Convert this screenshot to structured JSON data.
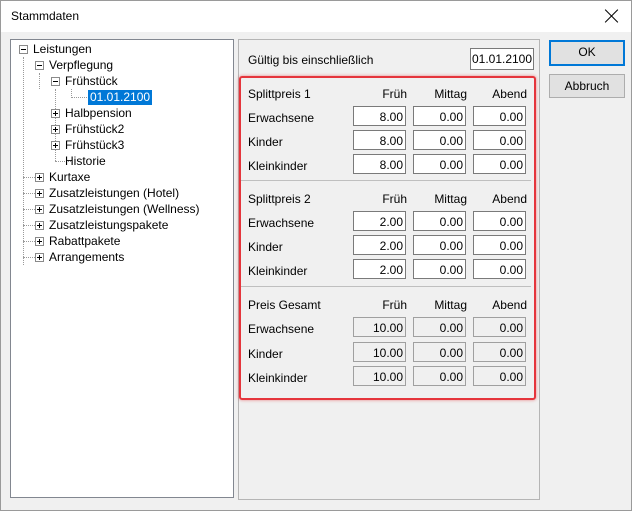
{
  "window": {
    "title": "Stammdaten"
  },
  "tree": {
    "items": [
      {
        "label": "Leistungen"
      },
      {
        "label": "Verpflegung"
      },
      {
        "label": "Frühstück"
      },
      {
        "label": "01.01.2100"
      },
      {
        "label": "Halbpension"
      },
      {
        "label": "Frühstück2"
      },
      {
        "label": "Frühstück3"
      },
      {
        "label": "Historie"
      },
      {
        "label": "Kurtaxe"
      },
      {
        "label": "Zusatzleistungen (Hotel)"
      },
      {
        "label": "Zusatzleistungen (Wellness)"
      },
      {
        "label": "Zusatzleistungspakete"
      },
      {
        "label": "Rabattpakete"
      },
      {
        "label": "Arrangements"
      }
    ]
  },
  "gueltig": {
    "label": "Gültig bis einschließlich",
    "value": "01.01.2100"
  },
  "sections": [
    {
      "title": "Splittpreis 1",
      "cols": [
        "Früh",
        "Mittag",
        "Abend"
      ],
      "rows": [
        {
          "label": "Erwachsene",
          "values": [
            "8.00",
            "0.00",
            "0.00"
          ]
        },
        {
          "label": "Kinder",
          "values": [
            "8.00",
            "0.00",
            "0.00"
          ]
        },
        {
          "label": "Kleinkinder",
          "values": [
            "8.00",
            "0.00",
            "0.00"
          ]
        }
      ]
    },
    {
      "title": "Splittpreis 2",
      "cols": [
        "Früh",
        "Mittag",
        "Abend"
      ],
      "rows": [
        {
          "label": "Erwachsene",
          "values": [
            "2.00",
            "0.00",
            "0.00"
          ]
        },
        {
          "label": "Kinder",
          "values": [
            "2.00",
            "0.00",
            "0.00"
          ]
        },
        {
          "label": "Kleinkinder",
          "values": [
            "2.00",
            "0.00",
            "0.00"
          ]
        }
      ]
    },
    {
      "title": "Preis Gesamt",
      "cols": [
        "Früh",
        "Mittag",
        "Abend"
      ],
      "rows": [
        {
          "label": "Erwachsene",
          "values": [
            "10.00",
            "0.00",
            "0.00"
          ]
        },
        {
          "label": "Kinder",
          "values": [
            "10.00",
            "0.00",
            "0.00"
          ]
        },
        {
          "label": "Kleinkinder",
          "values": [
            "10.00",
            "0.00",
            "0.00"
          ]
        }
      ]
    }
  ],
  "buttons": {
    "ok": "OK",
    "cancel": "Abbruch"
  },
  "colors": {
    "selection": "#0078d7",
    "highlight": "#e5353c"
  }
}
